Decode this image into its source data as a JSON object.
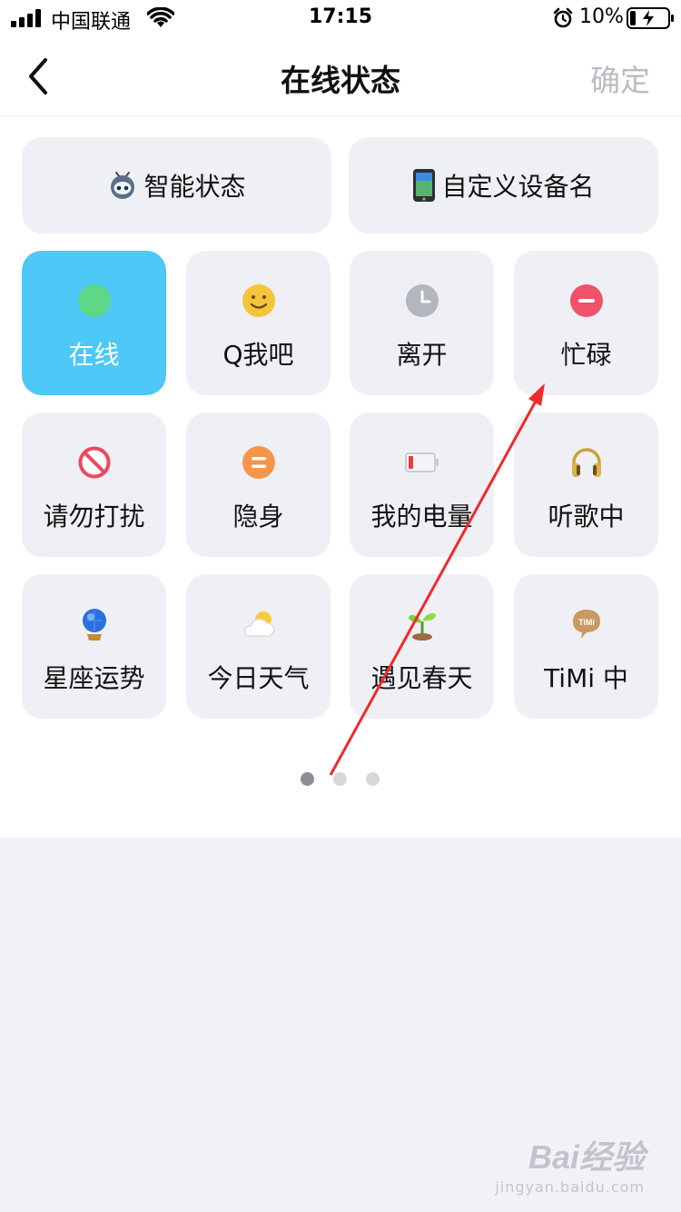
{
  "status_bar": {
    "carrier": "中国联通",
    "time": "17:15",
    "battery_percent": "10%"
  },
  "nav": {
    "title": "在线状态",
    "confirm_label": "确定"
  },
  "top_buttons": [
    {
      "label": "智能状态",
      "icon": "robot-icon"
    },
    {
      "label": "自定义设备名",
      "icon": "phone-icon"
    }
  ],
  "statuses": [
    {
      "label": "在线",
      "icon": "green-dot-icon",
      "selected": true
    },
    {
      "label": "Q我吧",
      "icon": "smiley-icon"
    },
    {
      "label": "离开",
      "icon": "clock-icon"
    },
    {
      "label": "忙碌",
      "icon": "minus-icon"
    },
    {
      "label": "请勿打扰",
      "icon": "no-entry-icon"
    },
    {
      "label": "隐身",
      "icon": "equals-icon"
    },
    {
      "label": "我的电量",
      "icon": "battery-low-icon"
    },
    {
      "label": "听歌中",
      "icon": "headphones-icon"
    },
    {
      "label": "星座运势",
      "icon": "crystal-ball-icon"
    },
    {
      "label": "今日天气",
      "icon": "partly-cloudy-icon"
    },
    {
      "label": "遇见春天",
      "icon": "sprout-icon"
    },
    {
      "label": "TiMi 中",
      "icon": "timi-icon",
      "icon_text": "TiMi"
    }
  ],
  "pager": {
    "pages": 3,
    "current": 1
  },
  "colors": {
    "selected_tile": "#4dc8f7",
    "tile_bg": "#eff0f5",
    "annotation_arrow": "#f02a2a"
  },
  "watermark": {
    "logo": "Bai经验",
    "url": "jingyan.baidu.com"
  }
}
